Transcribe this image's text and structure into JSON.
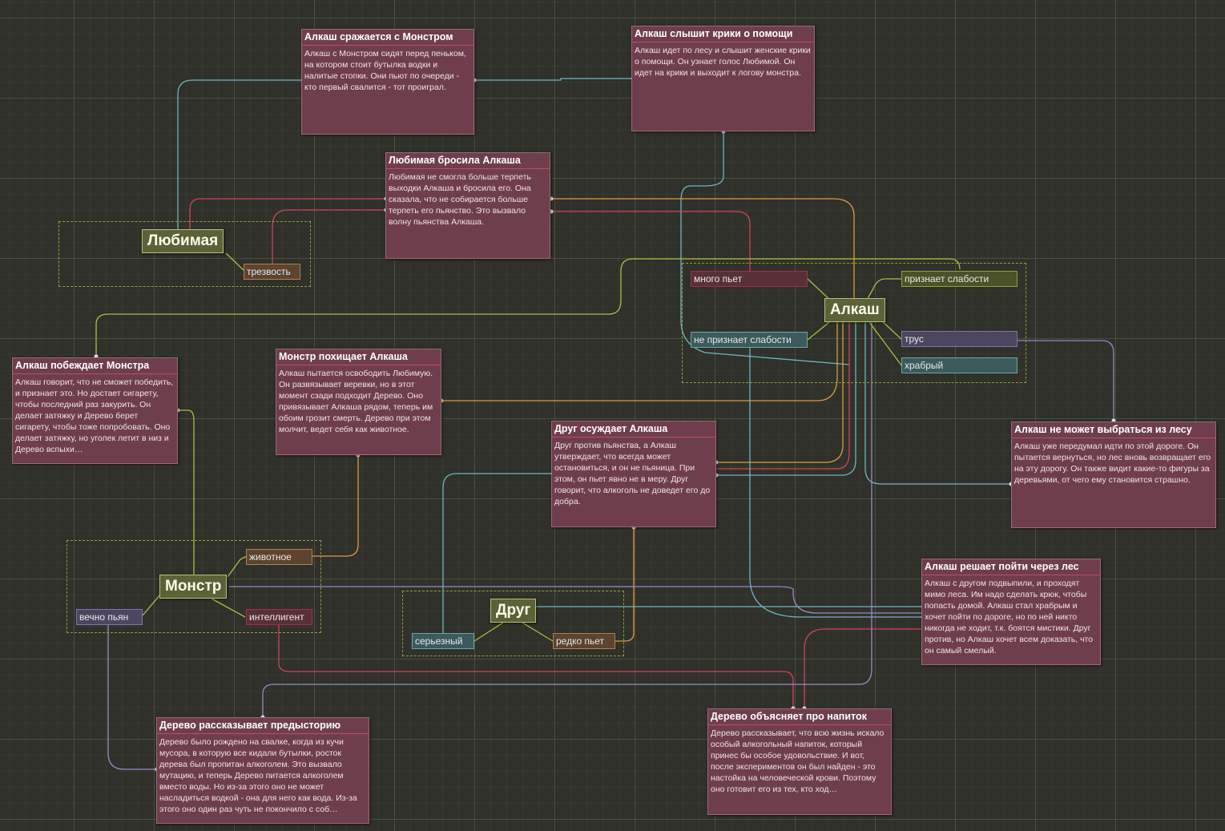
{
  "nodes": {
    "fight": {
      "title": "Алкаш сражается с Монстром",
      "text": "Алкаш с Монстром сидят перед пеньком, на котором стоит бутылка водки и налитые стопки. Они пьют по очереди - кто первый свалится - тот проиграл."
    },
    "hears": {
      "title": "Алкаш слышит крики о помощи",
      "text": "Алкаш идет по лесу и слышит женские крики о помощи. Он узнает голос Любимой. Он идет на крики и выходит к логову монстра."
    },
    "left": {
      "title": "Любимая бросила Алкаша",
      "text": "Любимая не смогла больше терпеть выходки Алкаша и бросила его. Она сказала, что не собирается больше терпеть его пьянство. Это вызвало волну пьянства Алкаша."
    },
    "wins": {
      "title": "Алкаш побеждает Монстра",
      "text": "Алкаш говорит, что не сможет победить, и признает это. Но достает сигарету, чтобы последний раз закурить. Он делает затяжку и Дерево берет сигарету, чтобы тоже попробовать. Оно делает затяжку, но уголек летит в низ и Дерево вспыхи…"
    },
    "kidnap": {
      "title": "Монстр похищает Алкаша",
      "text": "Алкаш пытается освободить Любимую. Он развязывает веревки, но в этот момент сзади подходит Дерево. Оно привязывает Алкаша рядом, теперь им обоим грозит смерть. Дерево при этом молчит, ведет себя как животное."
    },
    "friend_condemns": {
      "title": "Друг осуждает Алкаша",
      "text": "Друг против пьянства, а Алкаш утверждает, что всегда может остановиться, и он не пьяница. При этом, он пьет явно не в меру. Друг говорит, что алкоголь не доведет его до добра."
    },
    "lost": {
      "title": "Алкаш не может выбраться из лесу",
      "text": "Алкаш уже передумал идти по этой дороге. Он пытается вернуться, но лес вновь возвращает его на эту дорогу. Он также видит какие-то фигуры за деревьями, от чего ему становится страшно."
    },
    "decides": {
      "title": "Алкаш решает пойти через лес",
      "text": "Алкаш с другом подвыпили, и проходят мимо леса. Им надо сделать крюк, чтобы попасть домой. Алкаш стал храбрым и хочет пойти по дороге, но по ней никто никогда не ходит, т.к. боятся мистики. Друг против, но Алкаш хочет всем доказать, что он самый смелый."
    },
    "backstory": {
      "title": "Дерево рассказывает предысторию",
      "text": "Дерево было рождено на свалке, когда из кучи мусора, в которую все кидали бутылки, росток дерева был пропитан алкоголем. Это вызвало мутацию, и теперь Дерево питается алкоголем вместо воды. Но из-за этого оно не может насладиться водкой - она для него как вода. Из-за этого оно один раз чуть не покончило с соб…"
    },
    "drink": {
      "title": "Дерево объясняет про напиток",
      "text": "Дерево рассказывает, что всю жизнь искало особый алкогольный напиток, который принес бы особое удовольствие. И вот, после экспериментов он был найден - это настойка на человеческой крови. Поэтому оно готовит его из тех, кто ход…"
    }
  },
  "characters": {
    "lyubimaya": "Любимая",
    "alkash": "Алкаш",
    "monstr": "Монстр",
    "drug": "Друг"
  },
  "attributes": {
    "trezvost": "трезвость",
    "mnogo_pet": "много пьет",
    "priznaet": "признает слабости",
    "ne_priznaet": "не признает слабости",
    "trus": "трус",
    "hrabryi": "храбрый",
    "zhivotnoe": "животное",
    "vechno_pyan": "вечно пьян",
    "intelligent": "интеллигент",
    "serieznyi": "серьезный",
    "redko_pet": "редко пьет"
  },
  "colors": {
    "node_fill": "#6f3e4c",
    "node_accent": "#c04a66",
    "character_fill": "#5d6138",
    "group_border": "#8fa03a",
    "wire_teal": "#6fb4c0",
    "wire_red": "#d8405a",
    "wire_orange": "#e09a3a",
    "wire_green": "#a8c040",
    "wire_purple": "#9a8acb"
  }
}
